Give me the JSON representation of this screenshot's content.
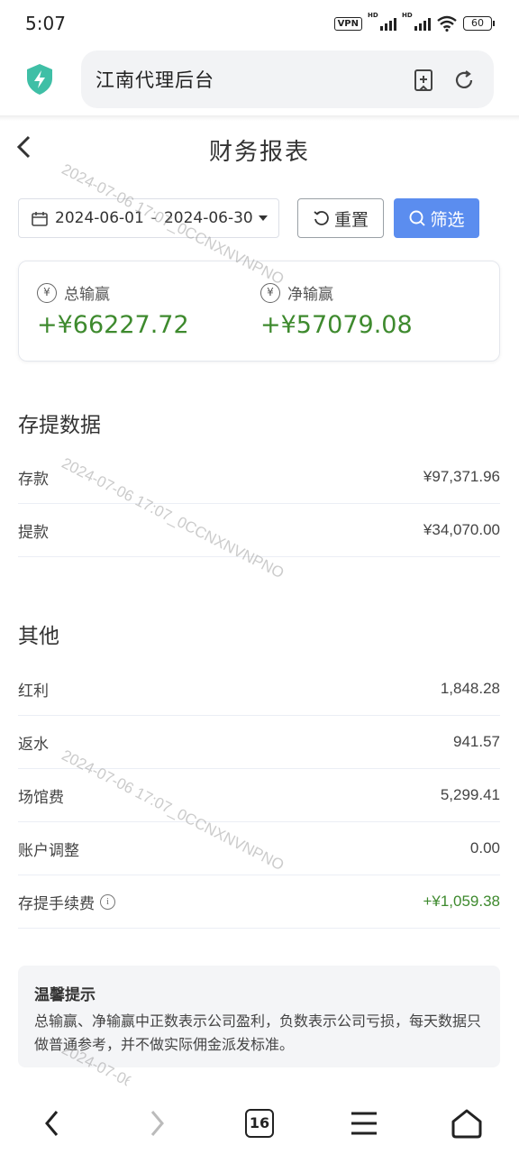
{
  "status_bar": {
    "time": "5:07",
    "vpn": "VPN",
    "hd1": "HD",
    "hd2": "HD",
    "battery": "60"
  },
  "browser": {
    "address_text": "江南代理后台"
  },
  "page": {
    "title": "财务报表"
  },
  "filter": {
    "start_date": "2024-06-01",
    "separator": "-",
    "end_date": "2024-06-30",
    "reset_label": "重置",
    "filter_label": "筛选"
  },
  "summary": {
    "yen_symbol": "¥",
    "total_label": "总输赢",
    "total_value": "+¥66227.72",
    "net_label": "净输赢",
    "net_value": "+¥57079.08"
  },
  "deposit_section": {
    "title": "存提数据",
    "rows": [
      {
        "label": "存款",
        "value": "¥97,371.96"
      },
      {
        "label": "提款",
        "value": "¥34,070.00"
      }
    ]
  },
  "other_section": {
    "title": "其他",
    "rows": [
      {
        "label": "红利",
        "value": "1,848.28"
      },
      {
        "label": "返水",
        "value": "941.57"
      },
      {
        "label": "场馆费",
        "value": "5,299.41"
      },
      {
        "label": "账户调整",
        "value": "0.00"
      },
      {
        "label": "存提手续费",
        "value": "+¥1,059.38"
      }
    ],
    "info_icon_glyph": "i"
  },
  "tips": {
    "title": "温馨提示",
    "body": "总输赢、净输赢中正数表示公司盈利，负数表示公司亏损，每天数据只做普通参考，并不做实际佣金派发标准。"
  },
  "watermark": {
    "text": "2024-07-06 17:07_0CCNXNVNPNO"
  },
  "bottom_nav": {
    "tab_count": "16"
  },
  "colors": {
    "accent": "#5b8def",
    "positive": "#3e8a2e",
    "shield": "#3fbfa6"
  }
}
